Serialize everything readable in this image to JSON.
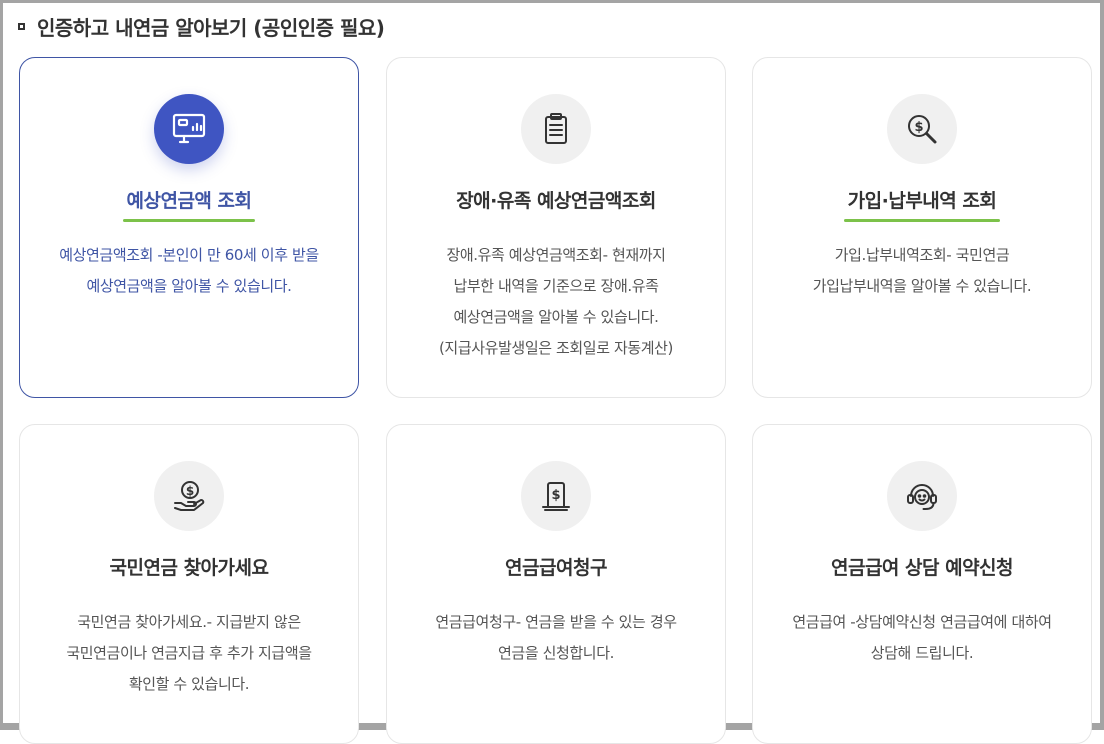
{
  "section": {
    "title": "인증하고 내연금 알아보기 (공인인증 필요)"
  },
  "cards": [
    {
      "title": "예상연금액 조회",
      "desc": [
        "예상연금액조회 -본인이 만 60세 이후 받을",
        "예상연금액을 알아볼 수 있습니다."
      ],
      "icon": "monitor-chart-icon"
    },
    {
      "title": "장애·유족 예상연금액조회",
      "desc": [
        "장애.유족 예상연금액조회- 현재까지",
        "납부한 내역을 기준으로 장애.유족",
        "예상연금액을 알아볼 수 있습니다.",
        "(지급사유발생일은 조회일로 자동계산)"
      ],
      "icon": "clipboard-icon"
    },
    {
      "title": "가입·납부내역 조회",
      "desc": [
        "가입.납부내역조회- 국민연금",
        "가입납부내역을 알아볼 수 있습니다."
      ],
      "icon": "magnifier-dollar-icon"
    },
    {
      "title": "국민연금 찾아가세요",
      "desc": [
        "국민연금 찾아가세요.- 지급받지 않은",
        "국민연금이나 연금지급 후 추가 지급액을",
        "확인할 수 있습니다."
      ],
      "icon": "hand-coin-icon"
    },
    {
      "title": "연금급여청구",
      "desc": [
        "연금급여청구- 연금을 받을 수 있는 경우",
        "연금을 신청합니다."
      ],
      "icon": "dollar-receipt-icon"
    },
    {
      "title": "연금급여 상담 예약신청",
      "desc": [
        "연금급여 -상담예약신청 연금급여에 대하여",
        "상담해 드립니다."
      ],
      "icon": "headset-icon"
    }
  ],
  "colors": {
    "accent_blue": "#3f55c2",
    "text_blue": "#3f55a5",
    "underline_green": "#7cc24a",
    "border_gray": "#e6e6e6"
  }
}
